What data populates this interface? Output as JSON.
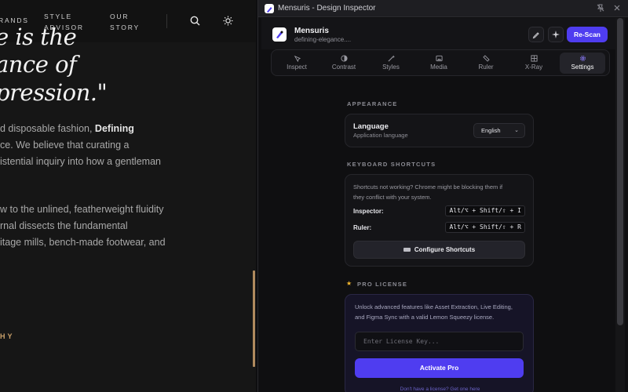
{
  "site": {
    "nav": {
      "brands": "RANDS",
      "style_advisor_1": "STYLE",
      "style_advisor_2": "ADVISOR",
      "our_story_1": "OUR",
      "our_story_2": "STORY"
    },
    "quote_lines": [
      "e is the",
      "ance of",
      "pression.\""
    ],
    "paragraph_1": [
      "d disposable fashion, ",
      "Defining",
      "ce. We believe that curating a",
      "istential inquiry into how a gentleman"
    ],
    "paragraph_2": [
      "w to the unlined, featherweight fluidity",
      "rnal dissects the fundamental",
      "itage mills, bench-made footwear, and"
    ],
    "gold_label": "HY"
  },
  "window": {
    "title": "Mensuris - Design Inspector"
  },
  "header": {
    "brand_name": "Mensuris",
    "brand_sub": "defining-elegance....",
    "rescan_label": "Re-Scan"
  },
  "tabs": [
    {
      "label": "Inspect",
      "icon": "crosshair-icon"
    },
    {
      "label": "Contrast",
      "icon": "contrast-icon"
    },
    {
      "label": "Styles",
      "icon": "magic-wand-icon"
    },
    {
      "label": "Media",
      "icon": "image-icon"
    },
    {
      "label": "Ruler",
      "icon": "ruler-icon"
    },
    {
      "label": "X-Ray",
      "icon": "grid-icon"
    },
    {
      "label": "Settings",
      "icon": "gear-icon",
      "active": true
    }
  ],
  "appearance": {
    "section_title": "APPEARANCE",
    "language_label": "Language",
    "language_sub": "Application language",
    "language_value": "English"
  },
  "shortcuts": {
    "section_title": "KEYBOARD SHORTCUTS",
    "note_1": "Shortcuts not working? Chrome might be blocking them if",
    "note_2": "they conflict with your system.",
    "inspector_label": "Inspector:",
    "inspector_keys": "Alt/⌥ + Shift/⇧ + I",
    "ruler_label": "Ruler:",
    "ruler_keys": "Alt/⌥ + Shift/⇧ + R",
    "configure_label": "Configure Shortcuts"
  },
  "pro": {
    "section_title": "PRO LICENSE",
    "note_1": "Unlock advanced features like Asset Extraction, Live Editing,",
    "note_2": "and Figma Sync with a valid Lemon Squeezy license.",
    "input_placeholder": "Enter License Key...",
    "activate_label": "Activate Pro",
    "footer": "Don't have a license? Get one here"
  },
  "colors": {
    "accent": "#4f3df0",
    "gold": "#c9a06a",
    "star": "#f5b82e"
  }
}
